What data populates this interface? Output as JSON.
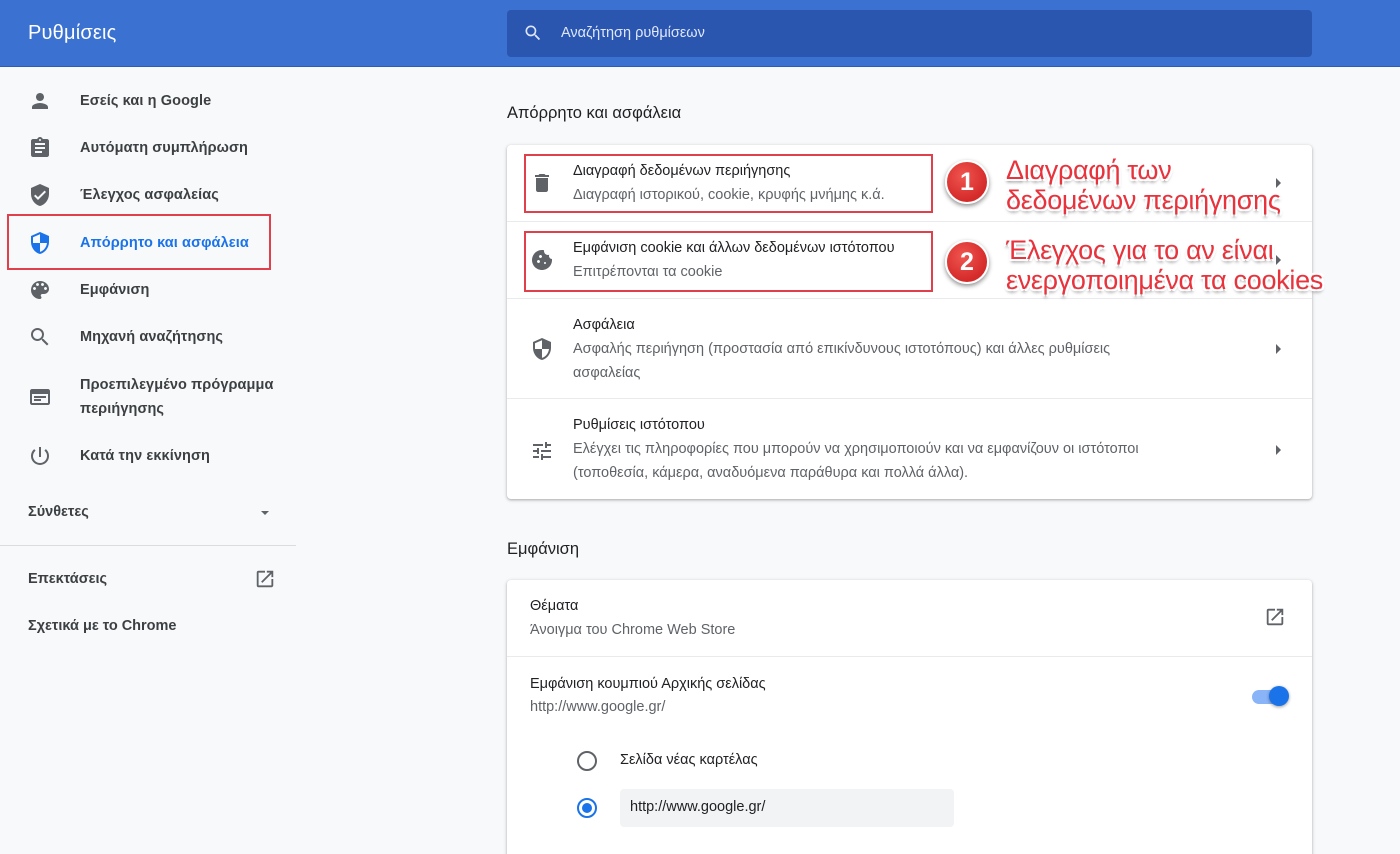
{
  "header": {
    "title": "Ρυθμίσεις",
    "search_placeholder": "Αναζήτηση ρυθμίσεων"
  },
  "sidebar": {
    "items": [
      {
        "label": "Εσείς και η Google",
        "icon": "person-icon"
      },
      {
        "label": "Αυτόματη συμπλήρωση",
        "icon": "clipboard-icon"
      },
      {
        "label": "Έλεγχος ασφαλείας",
        "icon": "shield-check-icon"
      },
      {
        "label": "Απόρρητο και ασφάλεια",
        "icon": "privacy-shield-icon",
        "active": true
      },
      {
        "label": "Εμφάνιση",
        "icon": "palette-icon"
      },
      {
        "label": "Μηχανή αναζήτησης",
        "icon": "search-icon"
      },
      {
        "label_line1": "Προεπιλεγμένο πρόγραμμα",
        "label_line2": "περιήγησης",
        "icon": "browser-window-icon"
      },
      {
        "label": "Κατά την εκκίνηση",
        "icon": "power-icon"
      }
    ],
    "advanced": "Σύνθετες",
    "extensions": "Επεκτάσεις",
    "about": "Σχετικά με το Chrome"
  },
  "privacy": {
    "section_title": "Απόρρητο και ασφάλεια",
    "rows": [
      {
        "title": "Διαγραφή δεδομένων περιήγησης",
        "subtitle": "Διαγραφή ιστορικού, cookie, κρυφής μνήμης κ.ά.",
        "icon": "trash-icon"
      },
      {
        "title": "Εμφάνιση cookie και άλλων δεδομένων ιστότοπου",
        "subtitle": "Επιτρέπονται τα cookie",
        "icon": "cookie-icon"
      },
      {
        "title": "Ασφάλεια",
        "subtitle_line1": "Ασφαλής περιήγηση (προστασία από επικίνδυνους ιστοτόπους) και άλλες ρυθμίσεις",
        "subtitle_line2": "ασφαλείας",
        "icon": "security-shield-icon"
      },
      {
        "title": "Ρυθμίσεις ιστότοπου",
        "subtitle_line1": "Ελέγχει τις πληροφορίες που μπορούν να χρησιμοποιούν και να εμφανίζουν οι ιστότοποι",
        "subtitle_line2": "(τοποθεσία, κάμερα, αναδυόμενα παράθυρα και πολλά άλλα).",
        "icon": "tune-icon"
      }
    ]
  },
  "annotations": [
    {
      "number": "1",
      "line1": "Διαγραφή των",
      "line2": "δεδομένων περιήγησης"
    },
    {
      "number": "2",
      "line1": "Έλεγχος για το αν είναι",
      "line2": "ενεργοποιημένα τα cookies"
    }
  ],
  "appearance": {
    "section_title": "Εμφάνιση",
    "themes_title": "Θέματα",
    "themes_subtitle": "Άνοιγμα του Chrome Web Store",
    "home_button_title": "Εμφάνιση κουμπιού Αρχικής σελίδας",
    "home_button_subtitle": "http://www.google.gr/",
    "home_button_enabled": true,
    "radio_new_tab": "Σελίδα νέας καρτέλας",
    "custom_url_value": "http://www.google.gr/",
    "selected_option": "custom_url"
  },
  "colors": {
    "header": "#3b71d0",
    "accent": "#1a73e8",
    "annotation": "#e8323c"
  }
}
